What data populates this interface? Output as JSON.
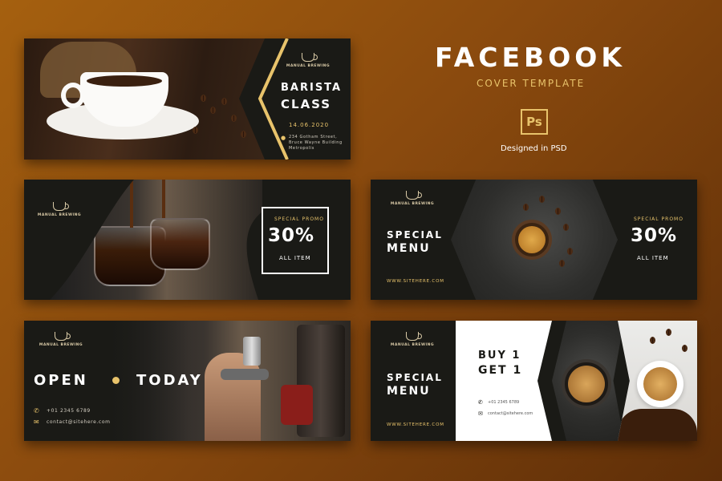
{
  "header": {
    "title": "FACEBOOK",
    "subtitle": "COVER TEMPLATE",
    "ps_label": "Ps",
    "designed": "Designed in PSD"
  },
  "logo_name": "MANUAL BREWING",
  "banner1": {
    "title_line1": "BARISTA",
    "title_line2": "CLASS",
    "date": "14.06.2020",
    "address": [
      "234 Gotham Street,",
      "Bruce Wayne Building",
      "Metropolis"
    ]
  },
  "banner2": {
    "promo_label": "SPECIAL PROMO",
    "percent": "30%",
    "all_item": "ALL ITEM"
  },
  "banner3": {
    "title_line1": "SPECIAL",
    "title_line2": "MENU",
    "website": "WWW.SITEHERE.COM",
    "promo_label": "SPECIAL PROMO",
    "percent": "30%",
    "all_item": "ALL ITEM"
  },
  "banner4": {
    "open": "OPEN",
    "today": "TODAY",
    "phone": "+01 2345 6789",
    "email": "contact@sitehere.com"
  },
  "banner5": {
    "title_line1": "SPECIAL",
    "title_line2": "MENU",
    "website": "WWW.SITEHERE.COM",
    "buy_line1": "BUY 1",
    "buy_line2": "GET 1",
    "phone": "+01 2345 6789",
    "email": "contact@sitehere.com"
  },
  "colors": {
    "accent_gold": "#e8c36b",
    "banner_bg": "#1a1a16",
    "background": "#8a4a0e"
  }
}
